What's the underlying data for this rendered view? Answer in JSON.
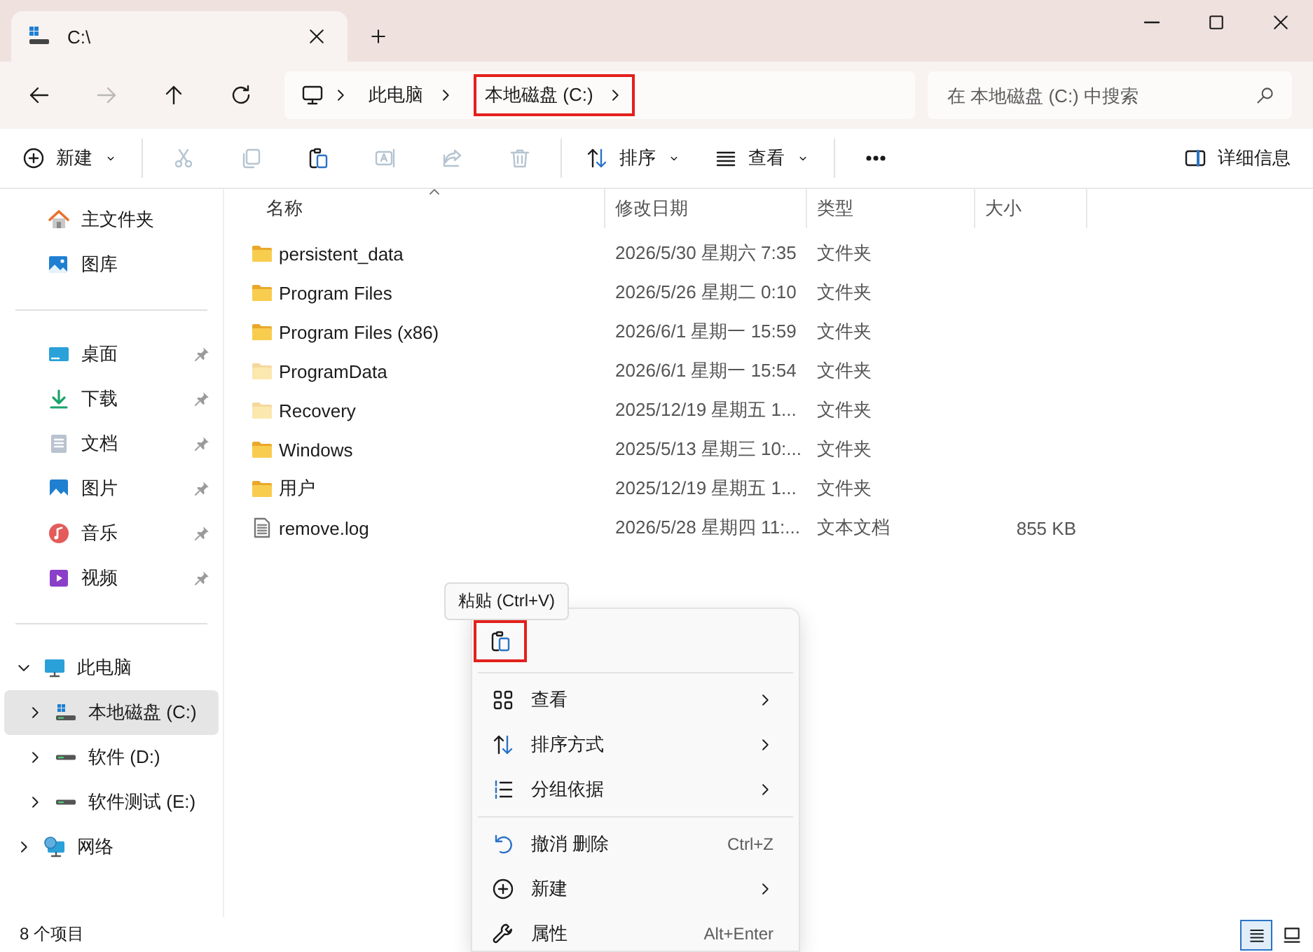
{
  "window": {
    "tab_title": "C:\\"
  },
  "navigation": [
    {
      "disabled": false
    },
    {
      "disabled": true
    },
    {
      "disabled": false
    },
    {
      "disabled": false
    }
  ],
  "breadcrumb": [
    {
      "label": "此电脑",
      "highlighted": false
    },
    {
      "label": "本地磁盘 (C:)",
      "highlighted": true
    }
  ],
  "search": {
    "placeholder": "在 本地磁盘 (C:) 中搜索"
  },
  "toolbar": {
    "groups": [
      [
        {
          "label": "新建",
          "disabled": false,
          "dropdown": true
        }
      ],
      [
        {
          "disabled": true,
          "dropdown": false
        },
        {
          "disabled": true,
          "dropdown": false
        },
        {
          "disabled": false,
          "dropdown": false
        },
        {
          "disabled": true,
          "dropdown": false
        },
        {
          "disabled": true,
          "dropdown": false
        },
        {
          "disabled": true,
          "dropdown": false
        }
      ],
      [
        {
          "label": "排序",
          "disabled": false,
          "dropdown": true
        },
        {
          "label": "查看",
          "disabled": false,
          "dropdown": true
        }
      ],
      [
        {
          "disabled": false,
          "dropdown": false
        }
      ]
    ],
    "details_button": {
      "label": "详细信息"
    }
  },
  "sidebar": {
    "quick": [
      {
        "label": "主文件夹",
        "pinned": false
      },
      {
        "label": "图库",
        "pinned": false
      }
    ],
    "pinned": [
      {
        "label": "桌面",
        "pinned": true
      },
      {
        "label": "下载",
        "pinned": true
      },
      {
        "label": "文档",
        "pinned": true
      },
      {
        "label": "图片",
        "pinned": true
      },
      {
        "label": "音乐",
        "pinned": true
      },
      {
        "label": "视频",
        "pinned": true
      }
    ],
    "tree": [
      {
        "label": "此电脑",
        "expanded": true,
        "selected": false,
        "children": [
          {
            "label": "本地磁盘 (C:)",
            "expanded": false,
            "selected": true
          },
          {
            "label": "软件 (D:)",
            "expanded": false,
            "selected": false
          },
          {
            "label": "软件测试 (E:)",
            "expanded": false,
            "selected": false
          }
        ]
      },
      {
        "label": "网络",
        "expanded": false,
        "selected": false
      }
    ]
  },
  "table": {
    "columns": [
      {
        "label": "名称",
        "sorted": true
      },
      {
        "label": "修改日期",
        "sorted": false
      },
      {
        "label": "类型",
        "sorted": false
      },
      {
        "label": "大小",
        "sorted": false
      }
    ],
    "rows": [
      {
        "name": "persistent_data",
        "modified": "2026/5/30 星期六 7:35",
        "type": "文件夹",
        "kind": "folder",
        "hidden": false
      },
      {
        "name": "Program Files",
        "modified": "2026/5/26 星期二 0:10",
        "type": "文件夹",
        "kind": "folder",
        "hidden": false
      },
      {
        "name": "Program Files (x86)",
        "modified": "2026/6/1 星期一 15:59",
        "type": "文件夹",
        "kind": "folder",
        "hidden": false
      },
      {
        "name": "ProgramData",
        "modified": "2026/6/1 星期一 15:54",
        "type": "文件夹",
        "kind": "folder",
        "hidden": true
      },
      {
        "name": "Recovery",
        "modified": "2025/12/19 星期五 1...",
        "type": "文件夹",
        "kind": "folder",
        "hidden": true
      },
      {
        "name": "Windows",
        "modified": "2025/5/13 星期三 10:...",
        "type": "文件夹",
        "kind": "folder",
        "hidden": false
      },
      {
        "name": "用户",
        "modified": "2025/12/19 星期五 1...",
        "type": "文件夹",
        "kind": "folder",
        "hidden": false
      },
      {
        "name": "remove.log",
        "modified": "2026/5/28 星期四 11:...",
        "type": "文本文档",
        "size": "855 KB",
        "kind": "file",
        "hidden": false
      }
    ]
  },
  "context_menu": {
    "tooltip": "粘贴 (Ctrl+V)",
    "quick_actions": [
      {
        "highlighted": true
      }
    ],
    "sections": [
      [
        {
          "label": "查看",
          "kind": "submenu"
        },
        {
          "label": "排序方式",
          "kind": "submenu"
        },
        {
          "label": "分组依据",
          "kind": "submenu"
        }
      ],
      [
        {
          "label": "撤消 删除",
          "kind": "command",
          "shortcut": "Ctrl+Z"
        },
        {
          "label": "新建",
          "kind": "submenu"
        },
        {
          "label": "属性",
          "kind": "command",
          "shortcut": "Alt+Enter"
        }
      ]
    ]
  },
  "status_bar": {
    "item_count": "8 个项目",
    "views": [
      {
        "selected": true
      },
      {
        "selected": false
      }
    ]
  }
}
